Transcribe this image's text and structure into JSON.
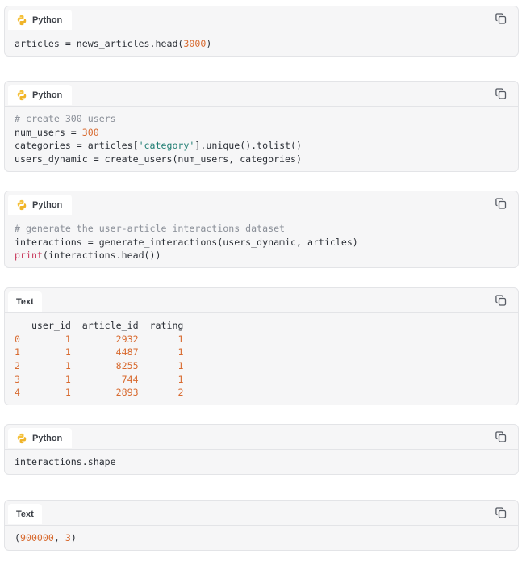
{
  "blocks": [
    {
      "language": "Python",
      "lines": [
        [
          {
            "t": "articles = news_articles.head(",
            "c": "op"
          },
          {
            "t": "3000",
            "c": "num"
          },
          {
            "t": ")",
            "c": "op"
          }
        ]
      ]
    },
    {
      "language": "Python",
      "lines": [
        [
          {
            "t": "# create 300 users",
            "c": "cm"
          }
        ],
        [
          {
            "t": "num_users = ",
            "c": "op"
          },
          {
            "t": "300",
            "c": "num"
          }
        ],
        [
          {
            "t": "categories = articles[",
            "c": "op"
          },
          {
            "t": "'category'",
            "c": "str"
          },
          {
            "t": "].unique().tolist()",
            "c": "op"
          }
        ],
        [
          {
            "t": "users_dynamic = create_users(num_users, categories)",
            "c": "op"
          }
        ]
      ]
    },
    {
      "language": "Python",
      "lines": [
        [
          {
            "t": "# generate the user-article interactions dataset",
            "c": "cm"
          }
        ],
        [
          {
            "t": "interactions = generate_interactions(users_dynamic, articles)",
            "c": "op"
          }
        ],
        [
          {
            "t": "print",
            "c": "kw"
          },
          {
            "t": "(interactions.head())",
            "c": "op"
          }
        ]
      ]
    },
    {
      "language": "Text",
      "lines": [
        [
          {
            "t": "   user_id  article_id  rating",
            "c": "op"
          }
        ],
        [
          {
            "t": "0",
            "c": "num"
          },
          {
            "t": "        ",
            "c": "op"
          },
          {
            "t": "1",
            "c": "num"
          },
          {
            "t": "        ",
            "c": "op"
          },
          {
            "t": "2932",
            "c": "num"
          },
          {
            "t": "       ",
            "c": "op"
          },
          {
            "t": "1",
            "c": "num"
          }
        ],
        [
          {
            "t": "1",
            "c": "num"
          },
          {
            "t": "        ",
            "c": "op"
          },
          {
            "t": "1",
            "c": "num"
          },
          {
            "t": "        ",
            "c": "op"
          },
          {
            "t": "4487",
            "c": "num"
          },
          {
            "t": "       ",
            "c": "op"
          },
          {
            "t": "1",
            "c": "num"
          }
        ],
        [
          {
            "t": "2",
            "c": "num"
          },
          {
            "t": "        ",
            "c": "op"
          },
          {
            "t": "1",
            "c": "num"
          },
          {
            "t": "        ",
            "c": "op"
          },
          {
            "t": "8255",
            "c": "num"
          },
          {
            "t": "       ",
            "c": "op"
          },
          {
            "t": "1",
            "c": "num"
          }
        ],
        [
          {
            "t": "3",
            "c": "num"
          },
          {
            "t": "        ",
            "c": "op"
          },
          {
            "t": "1",
            "c": "num"
          },
          {
            "t": "         ",
            "c": "op"
          },
          {
            "t": "744",
            "c": "num"
          },
          {
            "t": "       ",
            "c": "op"
          },
          {
            "t": "1",
            "c": "num"
          }
        ],
        [
          {
            "t": "4",
            "c": "num"
          },
          {
            "t": "        ",
            "c": "op"
          },
          {
            "t": "1",
            "c": "num"
          },
          {
            "t": "        ",
            "c": "op"
          },
          {
            "t": "2893",
            "c": "num"
          },
          {
            "t": "       ",
            "c": "op"
          },
          {
            "t": "2",
            "c": "num"
          }
        ]
      ]
    },
    {
      "language": "Python",
      "lines": [
        [
          {
            "t": "interactions.shape",
            "c": "op"
          }
        ]
      ]
    },
    {
      "language": "Text",
      "lines": [
        [
          {
            "t": "(",
            "c": "op"
          },
          {
            "t": "900000",
            "c": "num"
          },
          {
            "t": ", ",
            "c": "op"
          },
          {
            "t": "3",
            "c": "num"
          },
          {
            "t": ")",
            "c": "op"
          }
        ]
      ]
    }
  ],
  "icons": {
    "python": "python-logo-icon",
    "copy": "copy-icon"
  },
  "colors": {
    "comment": "#8a8f98",
    "number": "#d86a2f",
    "string": "#1f7d72",
    "keyword": "#c8375b"
  }
}
